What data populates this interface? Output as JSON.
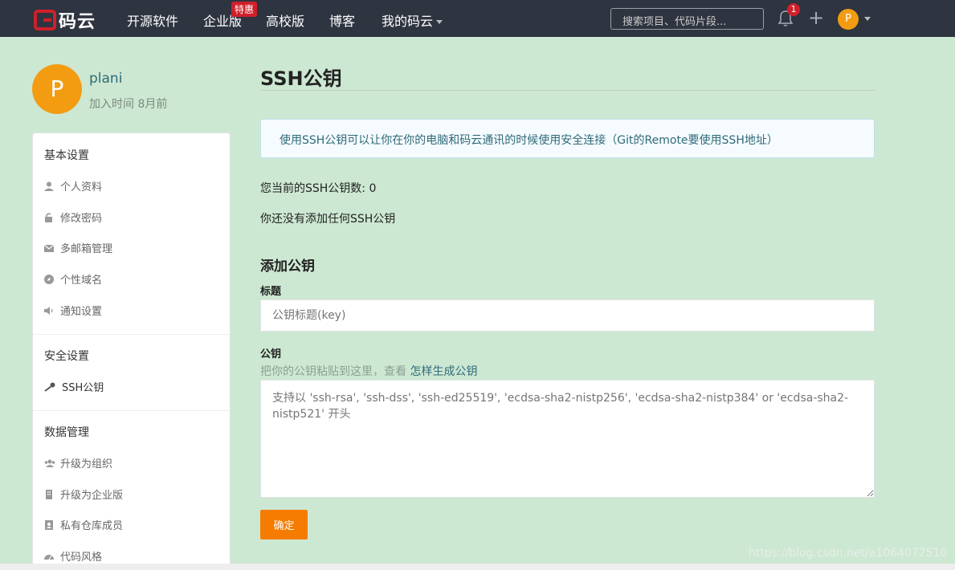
{
  "nav": {
    "logo_text": "码云",
    "items": [
      "开源软件",
      "企业版",
      "高校版",
      "博客",
      "我的码云"
    ],
    "special_badge": "特惠",
    "search_placeholder": "搜索项目、代码片段...",
    "notification_count": "1",
    "plus": "+",
    "avatar_letter": "P"
  },
  "profile": {
    "avatar_letter": "P",
    "username": "plani",
    "join_time": "加入时间 8月前"
  },
  "sidebar": {
    "groups": [
      {
        "title": "基本设置",
        "items": [
          "个人资料",
          "修改密码",
          "多邮箱管理",
          "个性域名",
          "通知设置"
        ]
      },
      {
        "title": "安全设置",
        "items": [
          "SSH公钥"
        ]
      },
      {
        "title": "数据管理",
        "items": [
          "升级为组织",
          "升级为企业版",
          "私有仓库成员",
          "代码风格"
        ]
      }
    ]
  },
  "main": {
    "title": "SSH公钥",
    "info": "使用SSH公钥可以让你在你的电脑和码云通讯的时候使用安全连接（Git的Remote要使用SSH地址）",
    "key_count": "您当前的SSH公钥数: 0",
    "no_keys": "你还没有添加任何SSH公钥",
    "add_title": "添加公钥",
    "label_title": "标题",
    "title_placeholder": "公钥标题(key)",
    "label_key": "公钥",
    "hint_text": "把你的公钥粘贴到这里，查看 ",
    "hint_link": "怎样生成公钥",
    "key_placeholder": "支持以 'ssh-rsa', 'ssh-dss', 'ssh-ed25519', 'ecdsa-sha2-nistp256', 'ecdsa-sha2-nistp384' or 'ecdsa-sha2-nistp521' 开头",
    "submit_label": "确定"
  },
  "watermark": "https://blog.csdn.net/a1064072510"
}
